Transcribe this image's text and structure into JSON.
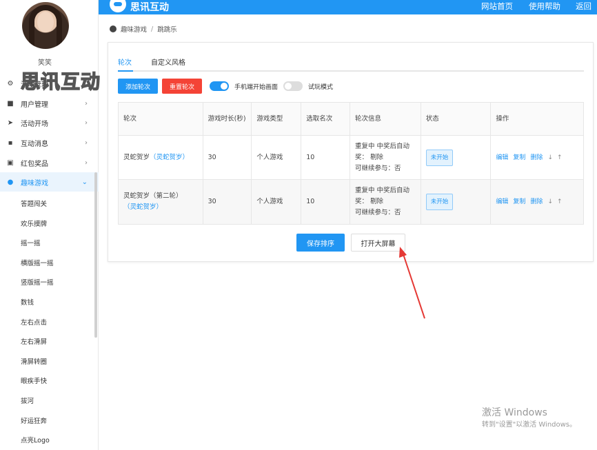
{
  "sidebar": {
    "username": "笑笑",
    "menu": [
      {
        "label": "活动管理",
        "icon": "gear-icon"
      },
      {
        "label": "用户管理",
        "icon": "lock-icon"
      },
      {
        "label": "活动开场",
        "icon": "send-icon"
      },
      {
        "label": "互动消息",
        "icon": "chat-icon"
      },
      {
        "label": "红包奖品",
        "icon": "gift-icon"
      },
      {
        "label": "趣味游戏",
        "icon": "pacman-icon"
      }
    ],
    "sub_items": [
      "答题闯关",
      "欢乐摸牌",
      "摇一摇",
      "横版摇一摇",
      "竖版摇一摇",
      "数钱",
      "左右点击",
      "左右滑屏",
      "滑屏转圈",
      "眼疾手快",
      "拔河",
      "好运狂奔",
      "点亮Logo"
    ]
  },
  "watermark": "思讯互动",
  "topbar": {
    "brand": "思讯互动",
    "nav": [
      "网站首页",
      "使用帮助",
      "返回"
    ]
  },
  "breadcrumb": [
    "趣味游戏",
    "跳跳乐"
  ],
  "tabs": [
    "轮次",
    "自定义风格"
  ],
  "toolbar": {
    "add_label": "添加轮次",
    "reset_label": "重置轮次",
    "toggle1_label": "手机端开始画面",
    "toggle2_label": "试玩模式"
  },
  "table": {
    "headers": [
      "轮次",
      "游戏时长(秒)",
      "游戏类型",
      "选取名次",
      "轮次信息",
      "状态",
      "操作"
    ],
    "rows": [
      {
        "name": "灵蛇贺岁",
        "style": "（灵蛇贺岁）",
        "duration": "30",
        "type": "个人游戏",
        "rank": "10",
        "info1": "重复中  中奖后自动",
        "info2": "奖：    剔除",
        "info3": "可继续参与：否",
        "status": "未开始"
      },
      {
        "name": "灵蛇贺岁（第二轮）",
        "style": "（灵蛇贺岁）",
        "duration": "30",
        "type": "个人游戏",
        "rank": "10",
        "info1": "重复中  中奖后自动",
        "info2": "奖：    剔除",
        "info3": "可继续参与：否",
        "status": "未开始"
      }
    ],
    "ops": [
      "编辑",
      "复制",
      "删除",
      "↓",
      "↑"
    ]
  },
  "footer_buttons": {
    "save_label": "保存排序",
    "screen_label": "打开大屏幕"
  },
  "windows": {
    "title": "激活 Windows",
    "subtitle": "转到\"设置\"以激活 Windows。"
  }
}
